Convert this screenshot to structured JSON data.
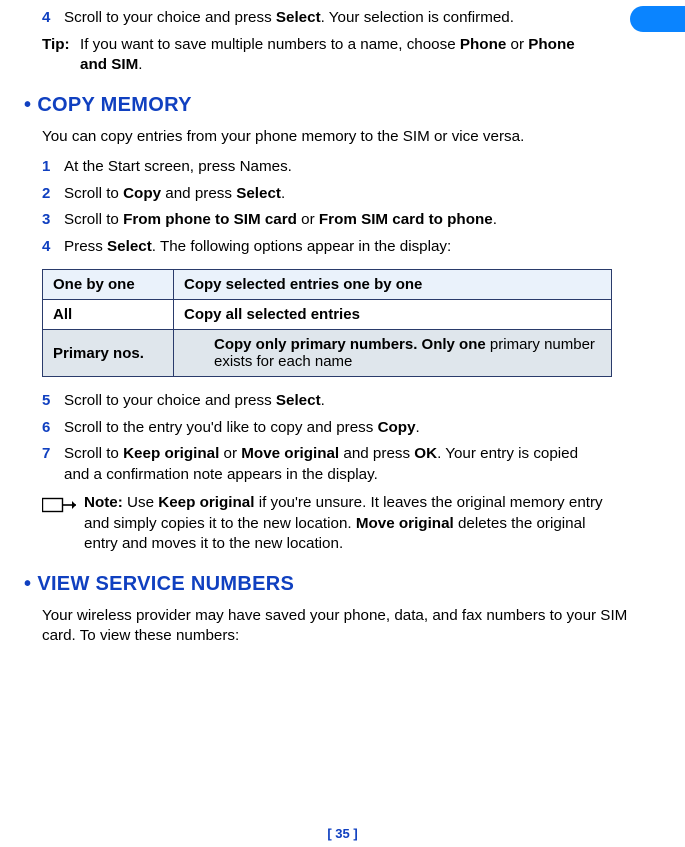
{
  "top": {
    "step4_num": "4",
    "step4_a": "Scroll to your choice and press ",
    "step4_b": "Select",
    "step4_c": ". Your selection is confirmed.",
    "tip_label": "Tip:",
    "tip_a": "If you want to save multiple numbers to a name, choose ",
    "tip_b": "Phone",
    "tip_c": " or ",
    "tip_d": "Phone and SIM",
    "tip_e": "."
  },
  "copy": {
    "heading": "COPY MEMORY",
    "intro": "You can copy entries from your phone memory to the SIM or vice versa.",
    "s1_num": "1",
    "s1_text": "At the Start screen, press Names.",
    "s2_num": "2",
    "s2_a": "Scroll to ",
    "s2_b": "Copy",
    "s2_c": " and press ",
    "s2_d": "Select",
    "s2_e": ".",
    "s3_num": "3",
    "s3_a": "Scroll to ",
    "s3_b": "From phone to SIM card",
    "s3_c": " or ",
    "s3_d": "From SIM card to phone",
    "s3_e": ".",
    "s4_num": "4",
    "s4_a": "Press ",
    "s4_b": "Select",
    "s4_c": ". The following options appear in the display:",
    "table": {
      "r1_left": "One by one",
      "r1_right": "Copy selected entries one by one",
      "r2_left": "All",
      "r2_right": "Copy all selected entries",
      "r3_left": "Primary nos.",
      "r3_right_a": "Copy only primary numbers. Only one",
      "r3_right_b": " primary number exists for each name"
    },
    "s5_num": "5",
    "s5_a": "Scroll to your choice and press ",
    "s5_b": "Select",
    "s5_c": ".",
    "s6_num": "6",
    "s6_a": "Scroll to the entry you'd like to copy and press ",
    "s6_b": "Copy",
    "s6_c": ".",
    "s7_num": "7",
    "s7_a": "Scroll to ",
    "s7_b": "Keep original",
    "s7_c": " or ",
    "s7_d": "Move original",
    "s7_e": " and press ",
    "s7_f": "OK",
    "s7_g": ". Your entry is copied and a confirmation note appears in the display.",
    "note_a": "Note:",
    "note_b": " Use ",
    "note_c": "Keep original",
    "note_d": " if you're unsure. It leaves the original memory entry and simply copies it to the new location. ",
    "note_e": "Move original",
    "note_f": " deletes the original entry and moves it to the new location."
  },
  "view": {
    "heading": "VIEW SERVICE NUMBERS",
    "intro": "Your wireless provider may have saved your phone, data, and fax numbers to your SIM card. To view these numbers:"
  },
  "footer": "[ 35 ]"
}
